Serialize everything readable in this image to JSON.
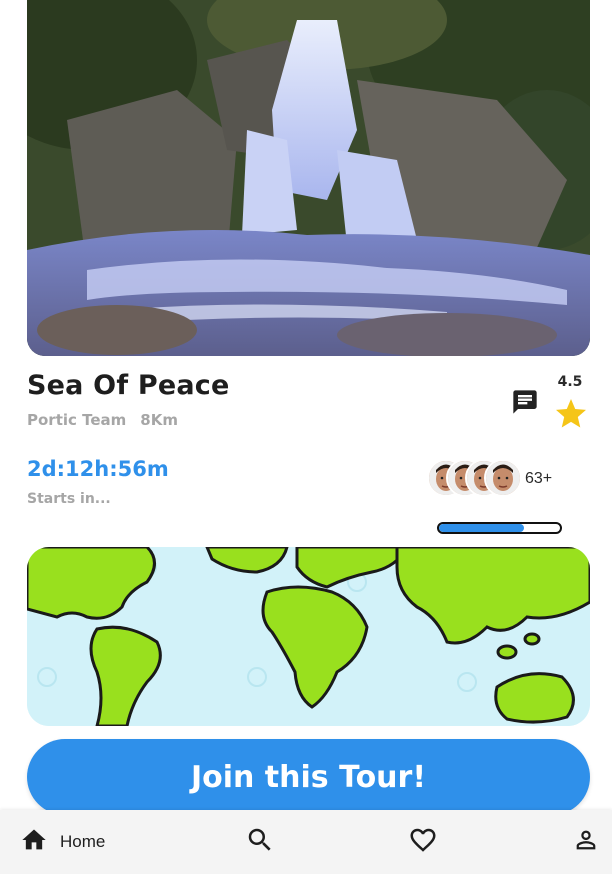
{
  "tour": {
    "title": "Sea Of Peace",
    "team": "Portic Team",
    "distance": "8Km",
    "rating": "4.5",
    "countdown": "2d:12h:56m",
    "starts_label": "Starts in...",
    "participants": "63+",
    "capacity_fill_fraction": 0.7
  },
  "actions": {
    "join_label": "Join this Tour!"
  },
  "nav": {
    "home_label": "Home",
    "items": [
      "home-icon",
      "search-icon",
      "heart-icon",
      "person-icon"
    ]
  },
  "colors": {
    "accent": "#2f90ea",
    "star": "#f5c518",
    "muted_text": "#a6a6a6",
    "map_land": "#99e01e",
    "map_water": "#d2f2f9"
  }
}
